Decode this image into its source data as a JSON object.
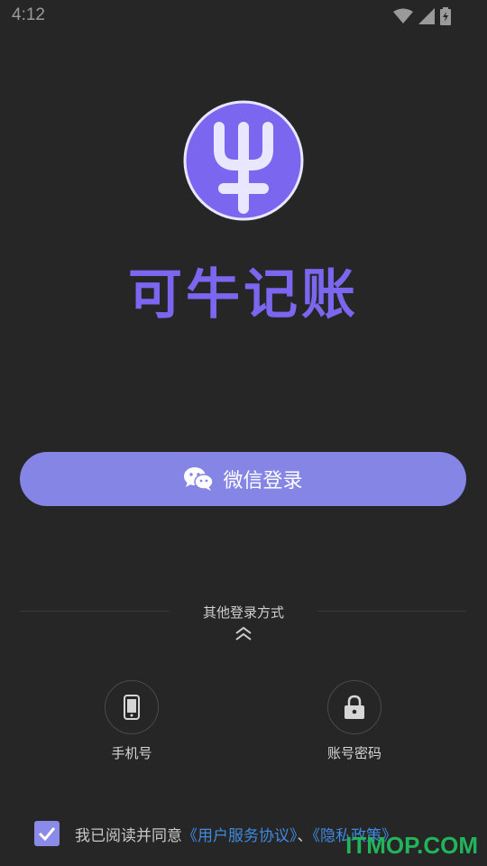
{
  "status_bar": {
    "time": "4:12",
    "icons": [
      "wifi-icon",
      "signal-icon",
      "battery-icon"
    ]
  },
  "app": {
    "name": "可牛记账",
    "logo_glyph": "牛",
    "accent_color": "#7b66f0"
  },
  "wechat_login": {
    "label": "微信登录",
    "icon": "wechat-icon",
    "color": "#8585e6"
  },
  "other_login": {
    "title": "其他登录方式",
    "options": [
      {
        "label": "手机号",
        "icon": "phone-icon"
      },
      {
        "label": "账号密码",
        "icon": "lock-icon"
      }
    ]
  },
  "agreement": {
    "checked": true,
    "prefix": "我已阅读并同意",
    "user_agreement": "《用户服务协议》",
    "separator": "、",
    "privacy_policy": "《隐私政策》",
    "link_color": "#3f8ae0"
  },
  "watermark": "ITMOP.COM"
}
